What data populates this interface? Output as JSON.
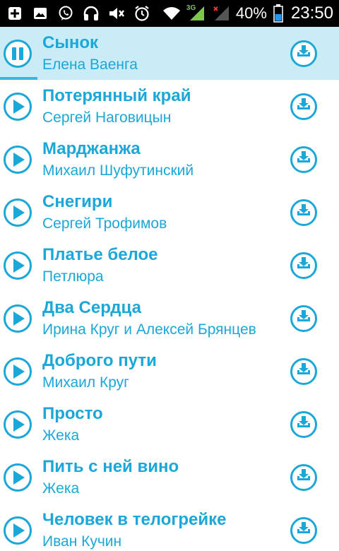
{
  "status_bar": {
    "network_label": "3G",
    "battery_percent": "40%",
    "time": "23:50",
    "icons": [
      "plus-icon",
      "image-icon",
      "viber-icon",
      "headphones-icon",
      "mute-icon",
      "alarm-icon",
      "wifi-icon",
      "signal-icon",
      "signal-no-icon",
      "battery-icon"
    ]
  },
  "colors": {
    "accent": "#1ba7d7",
    "playing_bg": "#c9ecf6",
    "progress": "#3ab6dd"
  },
  "tracks": [
    {
      "title": "Сынок",
      "artist": "Елена Ваенга",
      "state": "playing",
      "progress": 0.11
    },
    {
      "title": "Потерянный край",
      "artist": "Сергей Наговицын",
      "state": "stopped"
    },
    {
      "title": "Марджанжа",
      "artist": "Михаил Шуфутинский",
      "state": "stopped"
    },
    {
      "title": "Снегири",
      "artist": "Сергей Трофимов",
      "state": "stopped"
    },
    {
      "title": "Платье белое",
      "artist": "Петлюра",
      "state": "stopped"
    },
    {
      "title": "Два Сердца",
      "artist": "Ирина Круг и Алексей Брянцев",
      "state": "stopped"
    },
    {
      "title": "Доброго пути",
      "artist": "Михаил Круг",
      "state": "stopped"
    },
    {
      "title": "Просто",
      "artist": "Жека",
      "state": "stopped"
    },
    {
      "title": "Пить с ней вино",
      "artist": "Жека",
      "state": "stopped"
    },
    {
      "title": "Человек в телогрейке",
      "artist": "Иван Кучин",
      "state": "stopped"
    }
  ]
}
